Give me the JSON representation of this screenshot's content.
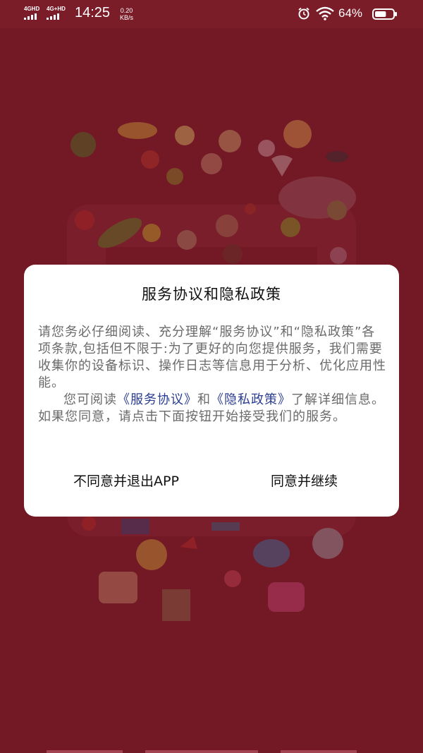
{
  "status_bar": {
    "sim1_label": "4GHD",
    "sim2_label": "4G+HD",
    "time": "14:25",
    "speed_value": "0.20",
    "speed_unit": "KB/s",
    "battery_percent": "64%",
    "battery_level": 0.64,
    "icons": [
      "signal-icon",
      "alarm-icon",
      "wifi-icon",
      "battery-icon"
    ]
  },
  "dialog": {
    "title": "服务协议和隐私政策",
    "paragraph1": "请您务必仔细阅读、充分理解“服务协议”和“隐私政策”各项条款,包括但不限于:为了更好的向您提供服务，我们需要收集你的设备标识、操作日志等信息用于分析、优化应用性能。",
    "paragraph2_prefix": "您可阅读",
    "service_link": "《服务协议》",
    "conjunction": "和",
    "privacy_link": "《隐私政策》",
    "paragraph2_suffix": "了解详细信息。如果您同意，请点击下面按钮开始接受我们的服务。",
    "decline_button": "不同意并退出APP",
    "agree_button": "同意并继续"
  },
  "colors": {
    "background": "#7a1d28",
    "link": "#2a3d92",
    "dialog_bg": "#ffffff"
  }
}
